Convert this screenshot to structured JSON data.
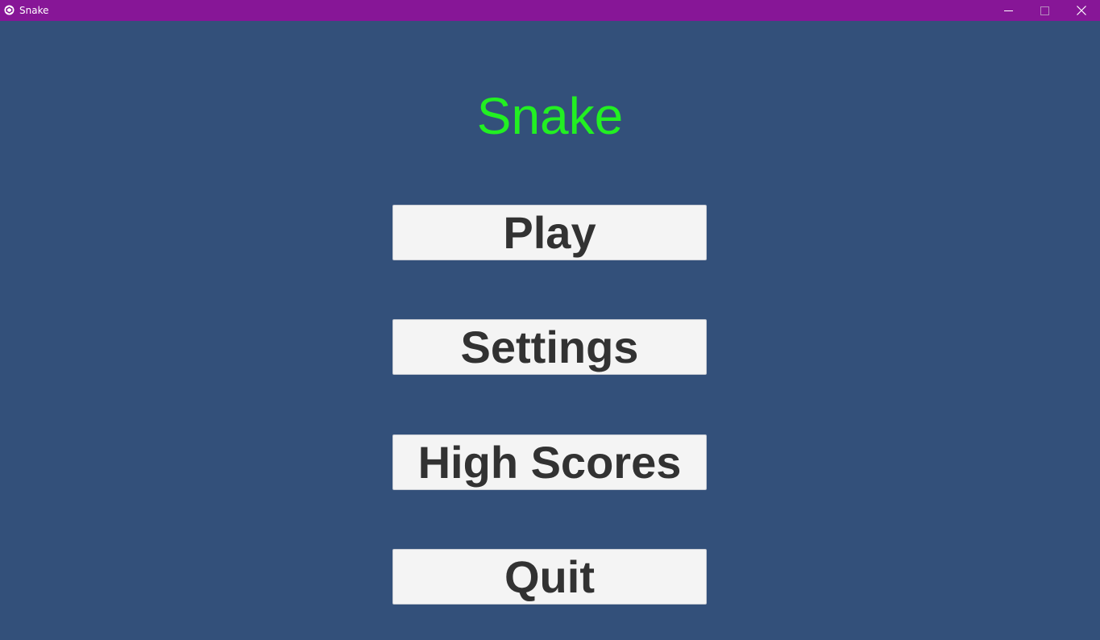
{
  "window": {
    "title": "Snake",
    "icon": "unity-logo-icon",
    "controls": {
      "minimize_icon": "minimize-icon",
      "maximize_icon": "maximize-icon",
      "close_icon": "close-icon"
    },
    "titlebar_color": "#871697"
  },
  "game": {
    "title": "Snake",
    "title_color": "#22F022",
    "background_color": "#33507A"
  },
  "menu": {
    "play_label": "Play",
    "settings_label": "Settings",
    "high_scores_label": "High Scores",
    "quit_label": "Quit"
  }
}
